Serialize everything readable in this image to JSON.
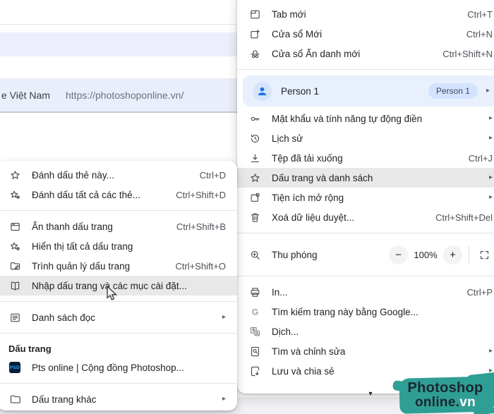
{
  "background": {
    "suggestion_text": "e Việt Nam",
    "suggestion_url": "https://photoshoponline.vn/"
  },
  "main_menu": {
    "items": [
      {
        "icon": "new-tab-icon",
        "label": "Tab mới",
        "shortcut": "Ctrl+T"
      },
      {
        "icon": "new-window-icon",
        "label": "Cửa sổ Mới",
        "shortcut": "Ctrl+N"
      },
      {
        "icon": "incognito-icon",
        "label": "Cửa sổ Ẩn danh mới",
        "shortcut": "Ctrl+Shift+N"
      },
      {
        "icon": "key-icon",
        "label": "Mật khẩu và tính năng tự động điền"
      },
      {
        "icon": "history-icon",
        "label": "Lịch sử"
      },
      {
        "icon": "download-icon",
        "label": "Tệp đã tải xuống",
        "shortcut": "Ctrl+J"
      },
      {
        "icon": "star-icon",
        "label": "Dấu trang và danh sách"
      },
      {
        "icon": "extension-icon",
        "label": "Tiện ích mở rộng"
      },
      {
        "icon": "trash-icon",
        "label": "Xoá dữ liệu duyệt...",
        "shortcut": "Ctrl+Shift+Del"
      },
      {
        "icon": "print-icon",
        "label": "In...",
        "shortcut": "Ctrl+P"
      },
      {
        "icon": "google-g-icon",
        "label": "Tìm kiếm trang này bằng Google..."
      },
      {
        "icon": "translate-icon",
        "label": "Dịch..."
      },
      {
        "icon": "find-edit-icon",
        "label": "Tìm và chỉnh sửa"
      },
      {
        "icon": "save-share-icon",
        "label": "Lưu và chia sẻ"
      }
    ],
    "profile": {
      "icon": "person-icon",
      "name": "Person 1",
      "badge": "Person 1"
    },
    "zoom": {
      "icon": "zoom-icon",
      "label": "Thu phóng",
      "minus": "−",
      "value": "100%",
      "plus": "+",
      "fullscreen": "fullscreen-icon"
    }
  },
  "submenu": {
    "items": [
      {
        "icon": "star-icon",
        "label": "Đánh dấu thẻ này...",
        "shortcut": "Ctrl+D"
      },
      {
        "icon": "stars-icon",
        "label": "Đánh dấu tất cả các thẻ...",
        "shortcut": "Ctrl+Shift+D"
      },
      {
        "icon": "bookmarks-bar-icon",
        "label": "Ẩn thanh dấu trang",
        "shortcut": "Ctrl+Shift+B"
      },
      {
        "icon": "all-bookmarks-icon",
        "label": "Hiển thị tất cả dấu trang"
      },
      {
        "icon": "bookmark-manager-icon",
        "label": "Trình quản lý dấu trang",
        "shortcut": "Ctrl+Shift+O"
      },
      {
        "icon": "import-bookmarks-icon",
        "label": "Nhập dấu trang và các mục cài đặt..."
      },
      {
        "icon": "reading-list-icon",
        "label": "Danh sách đọc"
      },
      {
        "icon": "psd-favicon",
        "label": "Pts online | Cộng đồng Photoshop..."
      },
      {
        "icon": "folder-icon",
        "label": "Dấu trang khác"
      }
    ],
    "section_header": "Dấu trang",
    "favicon_text": "PSD"
  },
  "logo": {
    "line1": "Photoshop",
    "line2_dark": "online.",
    "line2_light": "vn"
  },
  "icons": {
    "arrow_right": "▸",
    "scroll_down": "▾"
  },
  "colors": {
    "profile_highlight": "#e8f0fe",
    "badge": "#d3e3fd",
    "accent_blue": "#1a73e8",
    "hover_gray": "#e8e8e8",
    "logo_teal": "#2f9e94",
    "favicon_bg": "#001e36",
    "favicon_text": "#31a8ff"
  }
}
